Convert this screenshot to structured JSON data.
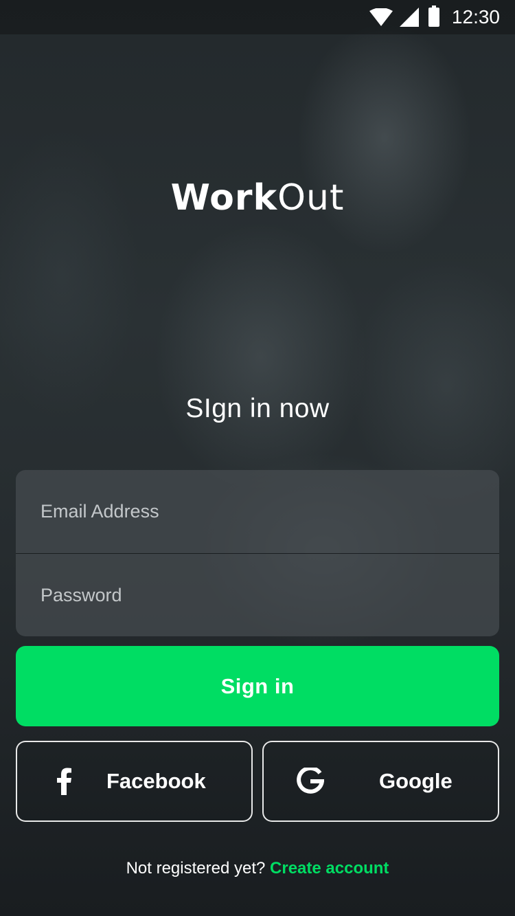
{
  "status_bar": {
    "time": "12:30",
    "icons": [
      "wifi-icon",
      "signal-icon",
      "battery-icon"
    ]
  },
  "logo": {
    "part1": "Work",
    "part2": "Out"
  },
  "headline": "SIgn in now",
  "form": {
    "email_placeholder": "Email Address",
    "password_placeholder": "Password",
    "email_value": "",
    "password_value": ""
  },
  "signin_button": "Sign in",
  "social": {
    "facebook_label": "Facebook",
    "facebook_icon": "facebook-icon",
    "google_label": "Google",
    "google_icon": "google-icon"
  },
  "footer": {
    "prompt": "Not registered yet?",
    "link": "Create account"
  },
  "colors": {
    "accent": "#00dd63",
    "card": "#464c50",
    "text": "#ffffff"
  }
}
